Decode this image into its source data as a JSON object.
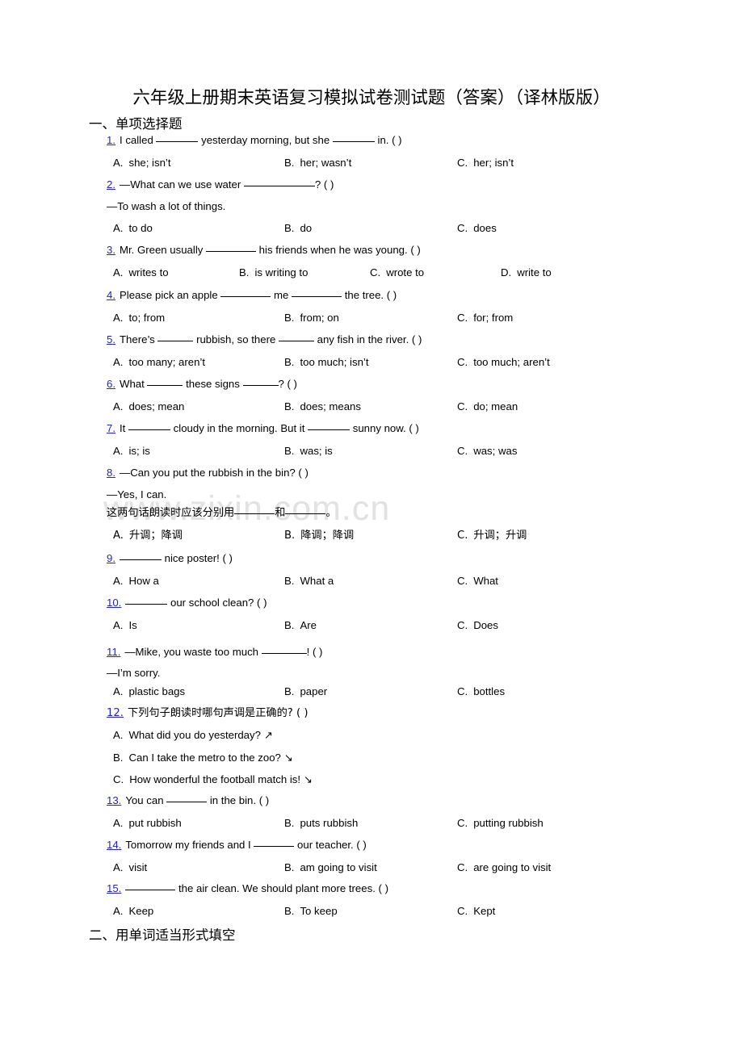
{
  "document": {
    "title": "六年级上册期末英语复习模拟试卷测试题（答案）（译林版版）",
    "watermark": "www.zixin.com.cn"
  },
  "sections": [
    {
      "id": "section-1",
      "label": "一、单项选择题"
    },
    {
      "id": "section-2",
      "label": "二、用单词适当形式填空"
    }
  ],
  "questions": [
    {
      "num": "1.",
      "stem_a": "I called ",
      "stem_b": " yesterday morning, but she ",
      "stem_c": " in. (    )",
      "options": [
        {
          "label": "A.",
          "text": "she; isn’t"
        },
        {
          "label": "B.",
          "text": "her; wasn’t"
        },
        {
          "label": "C.",
          "text": "her; isn’t"
        }
      ]
    },
    {
      "num": "2.",
      "stem_a": "—What can we use water ",
      "stem_b": "",
      "stem_c": "? (    )",
      "cont": "—To wash a lot of things.",
      "options": [
        {
          "label": "A.",
          "text": "to do"
        },
        {
          "label": "B.",
          "text": "do"
        },
        {
          "label": "C.",
          "text": "does"
        }
      ]
    },
    {
      "num": "3.",
      "stem_a": "Mr. Green usually ",
      "stem_b": "",
      "stem_c": " his friends when he was young. (    )",
      "options": [
        {
          "label": "A.",
          "text": "writes to"
        },
        {
          "label": "B.",
          "text": "is writing to"
        },
        {
          "label": "C.",
          "text": "wrote to"
        },
        {
          "label": "D.",
          "text": "write to"
        }
      ]
    },
    {
      "num": "4.",
      "stem_a": "Please pick an apple ",
      "stem_b": " me ",
      "stem_c": " the tree. (    )",
      "options": [
        {
          "label": "A.",
          "text": "to; from"
        },
        {
          "label": "B.",
          "text": "from; on"
        },
        {
          "label": "C.",
          "text": "for; from"
        }
      ]
    },
    {
      "num": "5.",
      "stem_a": "There’s ",
      "stem_b": " rubbish, so there ",
      "stem_c": " any fish in the river. (    )",
      "options": [
        {
          "label": "A.",
          "text": "too many; aren’t"
        },
        {
          "label": "B.",
          "text": "too much; isn’t"
        },
        {
          "label": "C.",
          "text": "too much; aren’t"
        }
      ]
    },
    {
      "num": "6.",
      "stem_a": "What ",
      "stem_b": " these signs ",
      "stem_c": "? (    )",
      "options": [
        {
          "label": "A.",
          "text": "does; mean"
        },
        {
          "label": "B.",
          "text": "does; means"
        },
        {
          "label": "C.",
          "text": "do; mean"
        }
      ]
    },
    {
      "num": "7.",
      "stem_a": "It ",
      "stem_b": " cloudy in the morning. But it ",
      "stem_c": " sunny now. (    )",
      "options": [
        {
          "label": "A.",
          "text": "is; is"
        },
        {
          "label": "B.",
          "text": "was; is"
        },
        {
          "label": "C.",
          "text": "was; was"
        }
      ]
    },
    {
      "num": "8.",
      "stem_a": "—Can you put the rubbish in the bin? (    )",
      "cont": "—Yes, I can.",
      "cont2_a": "这两句话朗读时应该分别用",
      "cont2_b": "和",
      "cont2_c": "。",
      "options": [
        {
          "label": "A.",
          "text": "升调；降调"
        },
        {
          "label": "B.",
          "text": "降调；降调"
        },
        {
          "label": "C.",
          "text": "升调；升调"
        }
      ]
    },
    {
      "num": "9.",
      "stem_a": "",
      "stem_b": "",
      "stem_c": " nice poster! (    )",
      "options": [
        {
          "label": "A.",
          "text": "How a"
        },
        {
          "label": "B.",
          "text": "What a"
        },
        {
          "label": "C.",
          "text": "What"
        }
      ]
    },
    {
      "num": "10.",
      "stem_a": "",
      "stem_b": "",
      "stem_c": " our school clean? (    )",
      "options": [
        {
          "label": "A.",
          "text": "Is"
        },
        {
          "label": "B.",
          "text": "Are"
        },
        {
          "label": "C.",
          "text": "Does"
        }
      ]
    },
    {
      "num": "11.",
      "stem_a": "—Mike, you waste too much ",
      "stem_b": "",
      "stem_c": "! (    )",
      "cont": "—I’m sorry.",
      "options": [
        {
          "label": "A.",
          "text": "plastic bags"
        },
        {
          "label": "B.",
          "text": "paper"
        },
        {
          "label": "C.",
          "text": "bottles"
        }
      ]
    },
    {
      "num": "12.",
      "stem_a": "下列句子朗读时哪句声调是正确的? (    )",
      "stacked_options": [
        {
          "label": "A.",
          "text": "What did you do yesterday?",
          "arrow": "↗"
        },
        {
          "label": "B.",
          "text": "Can I take the metro to the zoo?",
          "arrow": "↘"
        },
        {
          "label": "C.",
          "text": "How wonderful the football match is!",
          "arrow": "↘"
        }
      ]
    },
    {
      "num": "13.",
      "stem_a": "You can ",
      "stem_b": "",
      "stem_c": " in the bin. (    )",
      "options": [
        {
          "label": "A.",
          "text": "put rubbish"
        },
        {
          "label": "B.",
          "text": "puts rubbish"
        },
        {
          "label": "C.",
          "text": "putting rubbish"
        }
      ]
    },
    {
      "num": "14.",
      "stem_a": "Tomorrow my friends and I ",
      "stem_b": "",
      "stem_c": " our teacher. (    )",
      "options": [
        {
          "label": "A.",
          "text": "visit"
        },
        {
          "label": "B.",
          "text": "am going to visit"
        },
        {
          "label": "C.",
          "text": "are going to visit"
        }
      ]
    },
    {
      "num": "15.",
      "stem_a": "",
      "stem_b": "",
      "stem_c": " the air clean. We should plant more trees. (    )",
      "options": [
        {
          "label": "A.",
          "text": "Keep"
        },
        {
          "label": "B.",
          "text": "To keep"
        },
        {
          "label": "C.",
          "text": "Kept"
        }
      ]
    }
  ]
}
